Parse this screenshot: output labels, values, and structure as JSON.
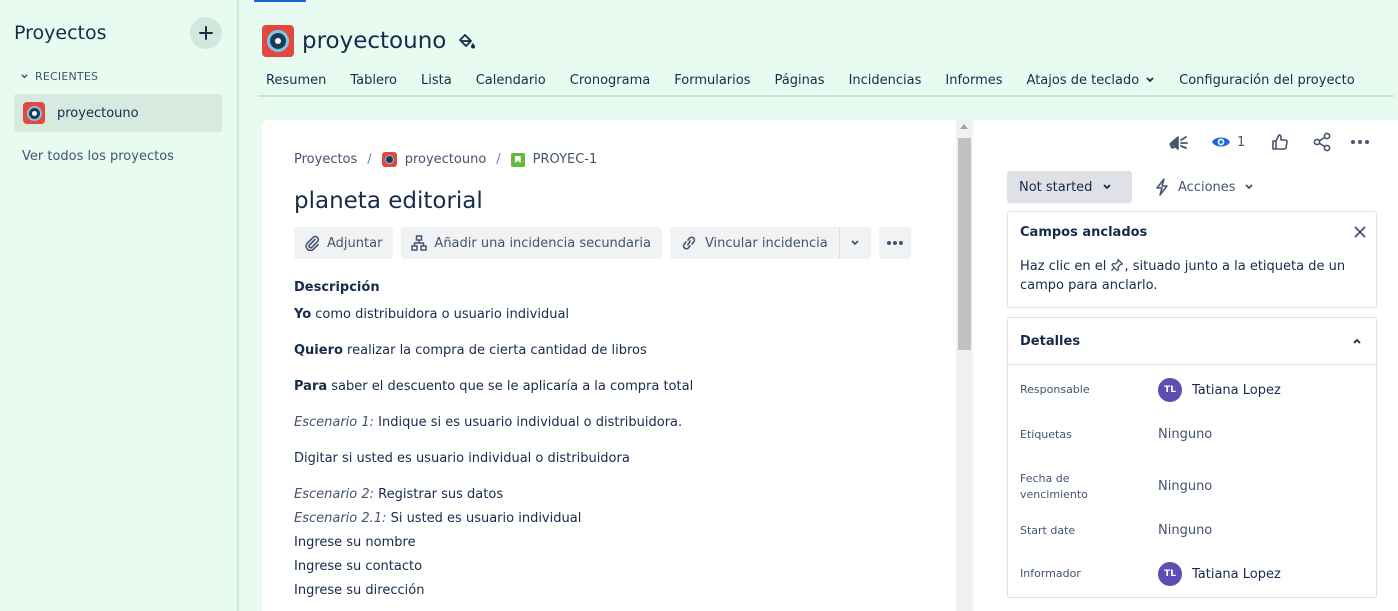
{
  "sidebar": {
    "title": "Proyectos",
    "add_icon": "plus-icon",
    "recent_label": "RECIENTES",
    "recent_projects": [
      {
        "label": "proyectouno"
      }
    ],
    "view_all_label": "Ver todos los proyectos"
  },
  "header": {
    "project_name": "proyectouno",
    "tabs": [
      {
        "label": "Resumen"
      },
      {
        "label": "Tablero"
      },
      {
        "label": "Lista"
      },
      {
        "label": "Calendario"
      },
      {
        "label": "Cronograma"
      },
      {
        "label": "Formularios"
      },
      {
        "label": "Páginas"
      },
      {
        "label": "Incidencias"
      },
      {
        "label": "Informes"
      },
      {
        "label": "Atajos de teclado"
      },
      {
        "label": "Configuración del proyecto"
      }
    ]
  },
  "issue": {
    "breadcrumb": {
      "root": "Proyectos",
      "project": "proyectouno",
      "key": "PROYEC-1"
    },
    "title": "planeta editorial",
    "actions": {
      "attach": "Adjuntar",
      "add_child": "Añadir una incidencia secundaria",
      "link": "Vincular incidencia"
    },
    "description": {
      "heading": "Descripción",
      "line1_bold": "Yo",
      "line1_rest": " como distribuidora o usuario individual",
      "line2_bold": "Quiero",
      "line2_rest": " realizar la compra de cierta cantidad de libros",
      "line3_bold": "Para",
      "line3_rest": " saber el descuento que se le aplicaría a la compra total",
      "scen1_em": "Escenario 1:",
      "scen1_rest": " Indique si es usuario individual o distribuidora.",
      "digit_line": "Digitar si usted es usuario individual o distribuidora",
      "scen2_em": "Escenario 2:",
      "scen2_rest": " Registrar sus datos",
      "scen21_em": "Escenario 2.1:",
      "scen21_rest": " Si usted es usuario individual",
      "l_nombre": "Ingrese su nombre",
      "l_contacto": "Ingrese su contacto",
      "l_direccion": "Ingrese su dirección"
    }
  },
  "panel": {
    "watch_count": "1",
    "status": "Not started",
    "actions_label": "Acciones",
    "pinned": {
      "title": "Campos anclados",
      "body_before": "Haz clic en el ",
      "body_after": ", situado junto a la etiqueta de un campo para anclarlo."
    },
    "details": {
      "title": "Detalles",
      "assignee_label": "Responsable",
      "assignee_initials": "TL",
      "assignee_name": "Tatiana Lopez",
      "labels_label": "Etiquetas",
      "labels_value": "Ninguno",
      "due_label": "Fecha de vencimiento",
      "due_value": "Ninguno",
      "start_label": "Start date",
      "start_value": "Ninguno",
      "reporter_label": "Informador",
      "reporter_initials": "TL",
      "reporter_name": "Tatiana Lopez"
    }
  },
  "colors": {
    "sidebar_bg": "#e7fbf0",
    "project_avatar": "#e2483d",
    "user_avatar": "#5e4db2",
    "story_green": "#63ba3c"
  }
}
